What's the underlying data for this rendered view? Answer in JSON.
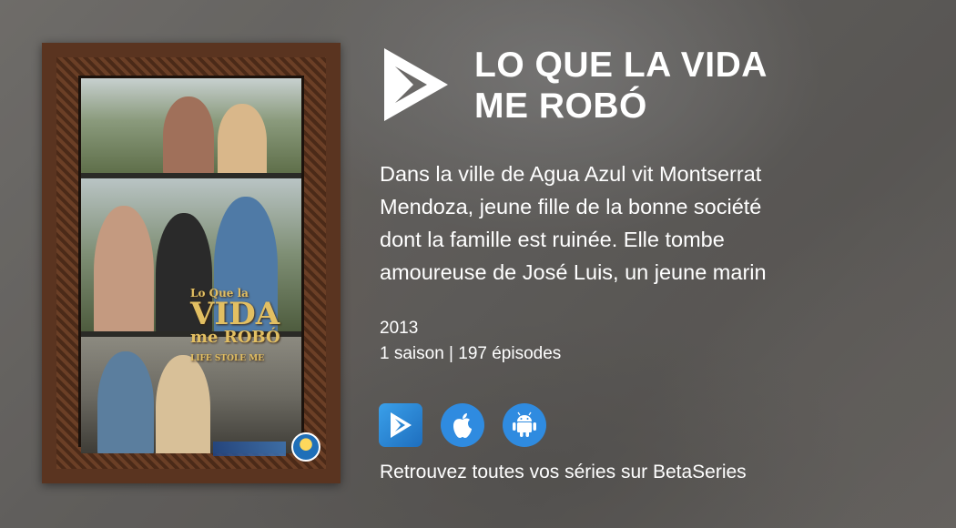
{
  "show": {
    "title_line1": "LO QUE LA VIDA",
    "title_line2": "ME ROBÓ",
    "description_lines": [
      "Dans la ville de Agua Azul vit Montserrat",
      "Mendoza, jeune fille de la bonne société",
      "dont la famille est ruinée. Elle tombe",
      "amoureuse de José Luis, un jeune marin"
    ],
    "year": "2013",
    "seasons_episodes": "1 saison | 197 épisodes"
  },
  "poster": {
    "logo_line1": "Lo Que la",
    "logo_line2": "VIDA",
    "logo_line3": "me ROBÓ",
    "subtitle": "LIFE STOLE ME"
  },
  "stores": [
    {
      "name": "BetaSeries app",
      "icon": "betaseries-app-icon"
    },
    {
      "name": "App Store",
      "icon": "apple-icon"
    },
    {
      "name": "Google Play",
      "icon": "android-icon"
    }
  ],
  "footer": {
    "tagline": "Retrouvez toutes vos séries sur BetaSeries"
  },
  "colors": {
    "accent_blue": "#2f8be0",
    "text": "#ffffff"
  }
}
